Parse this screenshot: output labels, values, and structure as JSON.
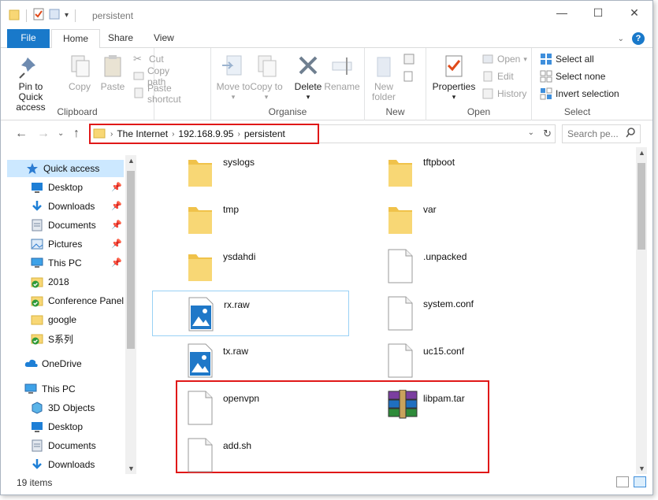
{
  "window": {
    "title": "persistent",
    "controls": {
      "minimize": "—",
      "maximize": "☐",
      "close": "✕"
    }
  },
  "tabs": {
    "file": "File",
    "home": "Home",
    "share": "Share",
    "view": "View"
  },
  "ribbon": {
    "clipboard": {
      "label": "Clipboard",
      "pin": "Pin to Quick access",
      "copy": "Copy",
      "paste": "Paste",
      "cut": "Cut",
      "copy_path": "Copy path",
      "paste_shortcut": "Paste shortcut"
    },
    "organise": {
      "label": "Organise",
      "move_to": "Move to",
      "copy_to": "Copy to",
      "delete": "Delete",
      "rename": "Rename"
    },
    "new": {
      "label": "New",
      "new_folder": "New folder"
    },
    "open": {
      "label": "Open",
      "properties": "Properties",
      "open": "Open",
      "edit": "Edit",
      "history": "History"
    },
    "select": {
      "label": "Select",
      "select_all": "Select all",
      "select_none": "Select none",
      "invert": "Invert selection"
    }
  },
  "address": {
    "crumbs": [
      "The Internet",
      "192.168.9.95",
      "persistent"
    ],
    "search_placeholder": "Search pe..."
  },
  "nav": {
    "quick_access": "Quick access",
    "items": [
      {
        "label": "Desktop",
        "pinned": true
      },
      {
        "label": "Downloads",
        "pinned": true
      },
      {
        "label": "Documents",
        "pinned": true
      },
      {
        "label": "Pictures",
        "pinned": true
      },
      {
        "label": "This PC",
        "pinned": true
      },
      {
        "label": "2018"
      },
      {
        "label": "Conference Panel"
      },
      {
        "label": "google"
      },
      {
        "label": "S系列"
      }
    ],
    "onedrive": "OneDrive",
    "this_pc": "This PC",
    "pc_items": [
      "3D Objects",
      "Desktop",
      "Documents",
      "Downloads"
    ]
  },
  "files": [
    {
      "name": "syslogs",
      "type": "folder"
    },
    {
      "name": "tftpboot",
      "type": "folder"
    },
    {
      "name": "tmp",
      "type": "folder"
    },
    {
      "name": "var",
      "type": "folder"
    },
    {
      "name": "ysdahdi",
      "type": "folder"
    },
    {
      "name": ".unpacked",
      "type": "file"
    },
    {
      "name": "rx.raw",
      "type": "image"
    },
    {
      "name": "system.conf",
      "type": "file"
    },
    {
      "name": "tx.raw",
      "type": "image"
    },
    {
      "name": "uc15.conf",
      "type": "file"
    },
    {
      "name": "openvpn",
      "type": "file"
    },
    {
      "name": "libpam.tar",
      "type": "archive"
    },
    {
      "name": "add.sh",
      "type": "file"
    }
  ],
  "status": {
    "count": "19 items"
  },
  "colors": {
    "accent": "#1979ca",
    "highlight": "#e01818",
    "folder": "#f8d775",
    "selection": "#cce8ff"
  }
}
